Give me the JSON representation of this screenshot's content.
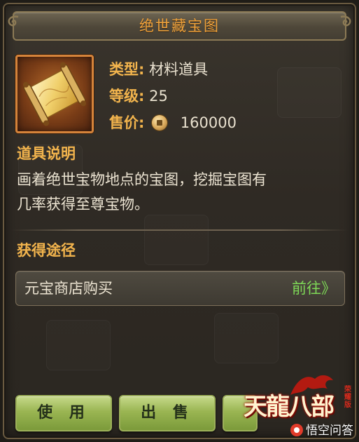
{
  "dialog": {
    "title": "绝世藏宝图"
  },
  "item": {
    "icon": "treasure-map-scroll-icon",
    "type_label": "类型:",
    "type_value": "材料道具",
    "level_label": "等级:",
    "level_value": "25",
    "price_label": "售价:",
    "price_icon": "copper-coin-icon",
    "price_value": "160000"
  },
  "description": {
    "heading": "道具说明",
    "line1": "画着绝世宝物地点的宝图，挖掘宝图有",
    "line2": "几率获得至尊宝物。"
  },
  "acquire": {
    "heading": "获得途径",
    "source_label": "元宝商店购买",
    "go_label": "前往》"
  },
  "buttons": {
    "use_label": "使 用",
    "sell_label": "出 售"
  },
  "branding": {
    "logo_text": "天龍八部",
    "logo_sub": "荣耀版",
    "watermark": "悟空问答"
  },
  "colors": {
    "title_orange": "#f0a23a",
    "label_gold": "#f2b44d",
    "go_green": "#7ed957",
    "button_green": "#9ab552",
    "item_border": "#d4833a"
  }
}
